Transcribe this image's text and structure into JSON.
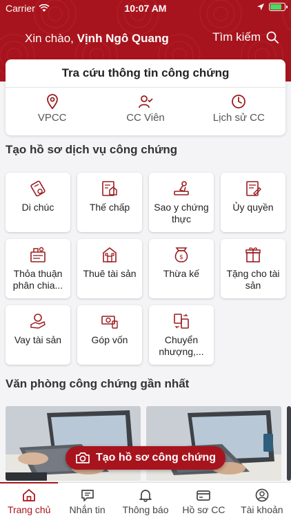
{
  "status_bar": {
    "carrier": "Carrier",
    "time": "10:07 AM"
  },
  "header": {
    "greeting_prefix": "Xin chào,",
    "user_name": "Vịnh Ngô Quang",
    "search_label": "Tìm kiếm"
  },
  "lookup": {
    "title": "Tra cứu thông tin công chứng",
    "items": [
      {
        "label": "VPCC",
        "icon": "location-pin-icon"
      },
      {
        "label": "CC Viên",
        "icon": "notary-person-icon"
      },
      {
        "label": "Lịch sử CC",
        "icon": "clock-icon"
      }
    ]
  },
  "services": {
    "title": "Tạo hồ sơ dịch vụ công chứng",
    "items": [
      {
        "label": "Di chúc",
        "icon": "will-scroll-icon"
      },
      {
        "label": "Thế chấp",
        "icon": "mortgage-house-icon"
      },
      {
        "label": "Sao y chứng thực",
        "icon": "stamp-icon"
      },
      {
        "label": "Ủy quyền",
        "icon": "authorization-document-icon"
      },
      {
        "label": "Thỏa thuận phân chia...",
        "icon": "agreement-icon"
      },
      {
        "label": "Thuê tài sản",
        "icon": "rental-building-icon"
      },
      {
        "label": "Thừa kế",
        "icon": "inheritance-bag-icon"
      },
      {
        "label": "Tặng cho tài sản",
        "icon": "gift-property-icon"
      },
      {
        "label": "Vay tài sản",
        "icon": "loan-hand-icon"
      },
      {
        "label": "Góp vốn",
        "icon": "capital-money-icon"
      },
      {
        "label": "Chuyển nhượng,...",
        "icon": "transfer-money-icon"
      }
    ]
  },
  "offices": {
    "title": "Văn phòng công chứng gần nhất"
  },
  "fab": {
    "label": "Tạo hồ sơ công chứng",
    "icon": "camera-icon"
  },
  "tabs": [
    {
      "label": "Trang chủ",
      "icon": "home-icon",
      "active": true
    },
    {
      "label": "Nhắn tin",
      "icon": "chat-icon",
      "active": false
    },
    {
      "label": "Thông báo",
      "icon": "bell-icon",
      "active": false
    },
    {
      "label": "Hồ sơ CC",
      "icon": "card-icon",
      "active": false
    },
    {
      "label": "Tài khoản",
      "icon": "account-icon",
      "active": false
    }
  ],
  "colors": {
    "brand": "#a8141d",
    "icon": "#9a1b1f",
    "battery": "#4cd964"
  }
}
